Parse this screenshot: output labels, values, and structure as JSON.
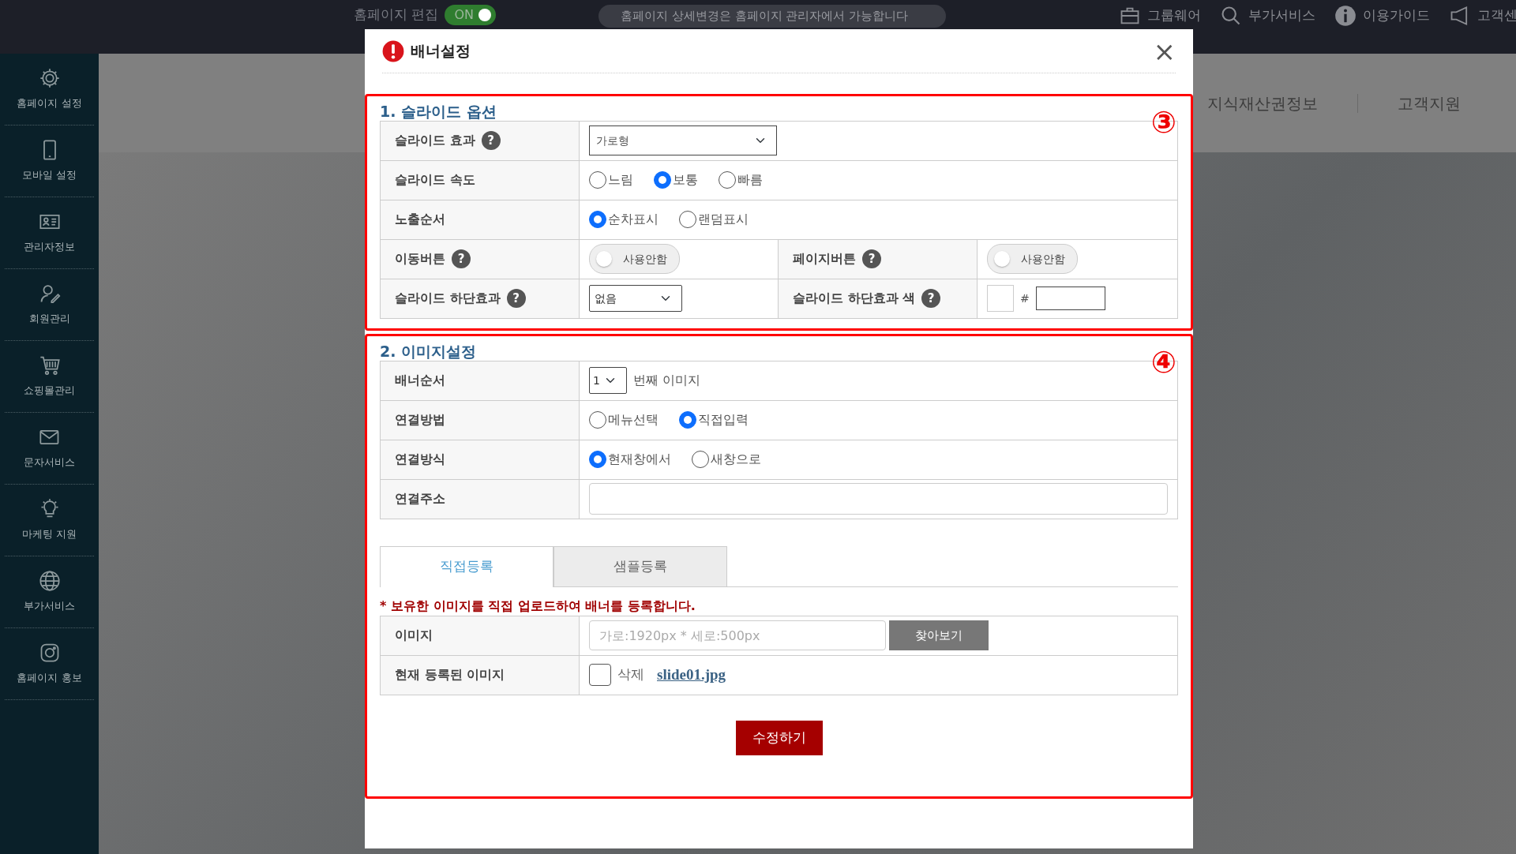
{
  "top_bar": {
    "edit_label": "홈페이지 편집",
    "edit_toggle": {
      "label": "ON",
      "on": true
    },
    "notice": "홈페이지 상세변경은 홈페이지 관리자에서 가능합니다",
    "links": [
      {
        "label": "그룹웨어"
      },
      {
        "label": "부가서비스"
      },
      {
        "label": "이용가이드"
      },
      {
        "label": "고객센"
      }
    ]
  },
  "sidebar": {
    "items": [
      {
        "label": "홈페이지 설정"
      },
      {
        "label": "모바일 설정"
      },
      {
        "label": "관리자정보"
      },
      {
        "label": "회원관리"
      },
      {
        "label": "쇼핑몰관리"
      },
      {
        "label": "문자서비스"
      },
      {
        "label": "마케팅 지원"
      },
      {
        "label": "부가서비스"
      },
      {
        "label": "홈페이지 홍보"
      }
    ]
  },
  "header_nav": [
    "지식재산권정보",
    "고객지원"
  ],
  "modal": {
    "title": "배너설정",
    "close": "×",
    "sections": [
      {
        "title": "1. 슬라이드 옵션",
        "marker": "③",
        "rows": [
          {
            "fields": [
              {
                "label": "슬라이드 효과",
                "help": "?",
                "control": {
                  "kind": "select",
                  "value": "가로형"
                }
              }
            ]
          },
          {
            "fields": [
              {
                "label": "슬라이드 속도",
                "control": {
                  "kind": "radios",
                  "options": [
                    {
                      "label": "느림",
                      "selected": false
                    },
                    {
                      "label": "보통",
                      "selected": true
                    },
                    {
                      "label": "빠름",
                      "selected": false
                    }
                  ]
                }
              }
            ]
          },
          {
            "fields": [
              {
                "label": "노출순서",
                "control": {
                  "kind": "radios",
                  "options": [
                    {
                      "label": "순차표시",
                      "selected": true
                    },
                    {
                      "label": "랜덤표시",
                      "selected": false
                    }
                  ]
                }
              }
            ]
          },
          {
            "fields": [
              {
                "label": "이동버튼",
                "help": "?",
                "control": {
                  "kind": "toggle",
                  "label": "사용안함",
                  "on": false
                }
              },
              {
                "label": "페이지버튼",
                "help": "?",
                "control": {
                  "kind": "toggle",
                  "label": "사용안함",
                  "on": false
                }
              }
            ]
          },
          {
            "fields": [
              {
                "label": "슬라이드 하단효과",
                "help": "?",
                "control": {
                  "kind": "small_select",
                  "value": "없음"
                }
              },
              {
                "label": "슬라이드 하단효과 색",
                "help": "?",
                "control": {
                  "kind": "color",
                  "prefix": "#"
                }
              }
            ]
          }
        ]
      },
      {
        "title": "2. 이미지설정",
        "marker": "④",
        "rows": [
          {
            "fields": [
              {
                "label": "배너순서",
                "control": {
                  "kind": "order",
                  "value": "1",
                  "suffix": "번째 이미지"
                }
              }
            ]
          },
          {
            "fields": [
              {
                "label": "연결방법",
                "control": {
                  "kind": "radios",
                  "options": [
                    {
                      "label": "메뉴선택",
                      "selected": false
                    },
                    {
                      "label": "직접입력",
                      "selected": true
                    }
                  ]
                }
              }
            ]
          },
          {
            "fields": [
              {
                "label": "연결방식",
                "control": {
                  "kind": "radios",
                  "options": [
                    {
                      "label": "현재창에서",
                      "selected": true
                    },
                    {
                      "label": "새창으로",
                      "selected": false
                    }
                  ]
                }
              }
            ]
          },
          {
            "fields": [
              {
                "label": "연결주소",
                "control": {
                  "kind": "text"
                }
              }
            ]
          }
        ],
        "tabs": [
          {
            "label": "직접등록",
            "selected": true
          },
          {
            "label": "샘플등록",
            "selected": false
          }
        ],
        "note": "* 보유한 이미지를 직접 업로드하여 배너를 등록합니다.",
        "upload_rows": [
          {
            "fields": [
              {
                "label": "이미지",
                "control": {
                  "kind": "file",
                  "placeholder": "가로:1920px * 세로:500px",
                  "button": "찾아보기"
                }
              }
            ]
          },
          {
            "fields": [
              {
                "label": "현재 등록된 이미지",
                "control": {
                  "kind": "current",
                  "checkbox": {
                    "label": "삭제",
                    "checked": false
                  },
                  "filename": "slide01.jpg"
                }
              }
            ]
          }
        ],
        "submit": "수정하기"
      }
    ]
  }
}
